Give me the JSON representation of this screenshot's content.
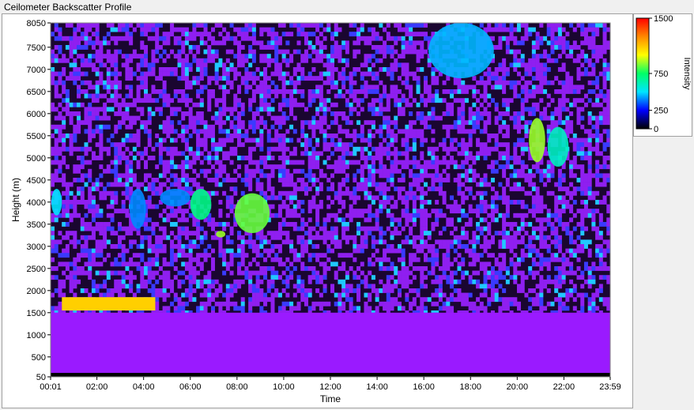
{
  "title": "Ceilometer Backscatter Profile",
  "chart_data": {
    "type": "heatmap",
    "title": "Ceilometer Backscatter Profile",
    "xlabel": "Time",
    "ylabel": "Height (m)",
    "x_ticks": [
      "00:01",
      "02:00",
      "04:00",
      "06:00",
      "08:00",
      "10:00",
      "12:00",
      "14:00",
      "16:00",
      "18:00",
      "20:00",
      "22:00",
      "23:59"
    ],
    "x_tick_hours": [
      0.0167,
      2,
      4,
      6,
      8,
      10,
      12,
      14,
      16,
      18,
      20,
      22,
      23.983
    ],
    "xlim": [
      0.0167,
      23.983
    ],
    "y_ticks": [
      "50",
      "500",
      "1000",
      "1500",
      "2000",
      "2500",
      "3000",
      "3500",
      "4000",
      "4500",
      "5000",
      "5500",
      "6000",
      "6500",
      "7000",
      "7500",
      "8050"
    ],
    "y_tick_values": [
      50,
      500,
      1000,
      1500,
      2000,
      2500,
      3000,
      3500,
      4000,
      4500,
      5000,
      5500,
      6000,
      6500,
      7000,
      7500,
      8050
    ],
    "ylim": [
      50,
      8050
    ],
    "colorbar": {
      "label": "Intensity",
      "ticks": [
        "1500",
        "750",
        "250",
        "0"
      ],
      "tick_values": [
        1500,
        750,
        250,
        0
      ],
      "range": [
        0,
        1500
      ],
      "colors": [
        "#000000",
        "#0000ff",
        "#00e5ff",
        "#00ff66",
        "#ffff00",
        "#ff8800",
        "#ff0000"
      ]
    },
    "background_colors": {
      "low": "#000000",
      "noise": "#8f1ff0",
      "boundary_layer": "#9a1aff"
    },
    "features": [
      {
        "kind": "boundary-layer",
        "time_hours": [
          0,
          24
        ],
        "height_m": [
          50,
          1500
        ],
        "intensity": 150
      },
      {
        "kind": "cloud-layer",
        "time_hours": [
          0.5,
          4.5
        ],
        "height_m": [
          1000,
          2100
        ],
        "intensity": 1100
      },
      {
        "kind": "cloud",
        "time_hours": [
          0.05,
          0.5
        ],
        "height_m": [
          3700,
          4300
        ],
        "intensity": 500
      },
      {
        "kind": "cloud",
        "time_hours": [
          3.4,
          4.1
        ],
        "height_m": [
          3400,
          4300
        ],
        "intensity": 400
      },
      {
        "kind": "cloud",
        "time_hours": [
          4.7,
          6.0
        ],
        "height_m": [
          3900,
          4300
        ],
        "intensity": 400
      },
      {
        "kind": "cloud",
        "time_hours": [
          6.0,
          6.9
        ],
        "height_m": [
          3600,
          4300
        ],
        "intensity": 700
      },
      {
        "kind": "cloud",
        "time_hours": [
          7.1,
          7.5
        ],
        "height_m": [
          3200,
          3350
        ],
        "intensity": 900
      },
      {
        "kind": "cloud",
        "time_hours": [
          7.9,
          9.4
        ],
        "height_m": [
          3300,
          4200
        ],
        "intensity": 850
      },
      {
        "kind": "cloud",
        "time_hours": [
          16.2,
          19.0
        ],
        "height_m": [
          6800,
          8050
        ],
        "intensity": 450
      },
      {
        "kind": "cloud",
        "time_hours": [
          20.5,
          21.2
        ],
        "height_m": [
          4900,
          5900
        ],
        "intensity": 900
      },
      {
        "kind": "cloud",
        "time_hours": [
          21.3,
          22.2
        ],
        "height_m": [
          4800,
          5700
        ],
        "intensity": 600
      }
    ]
  }
}
